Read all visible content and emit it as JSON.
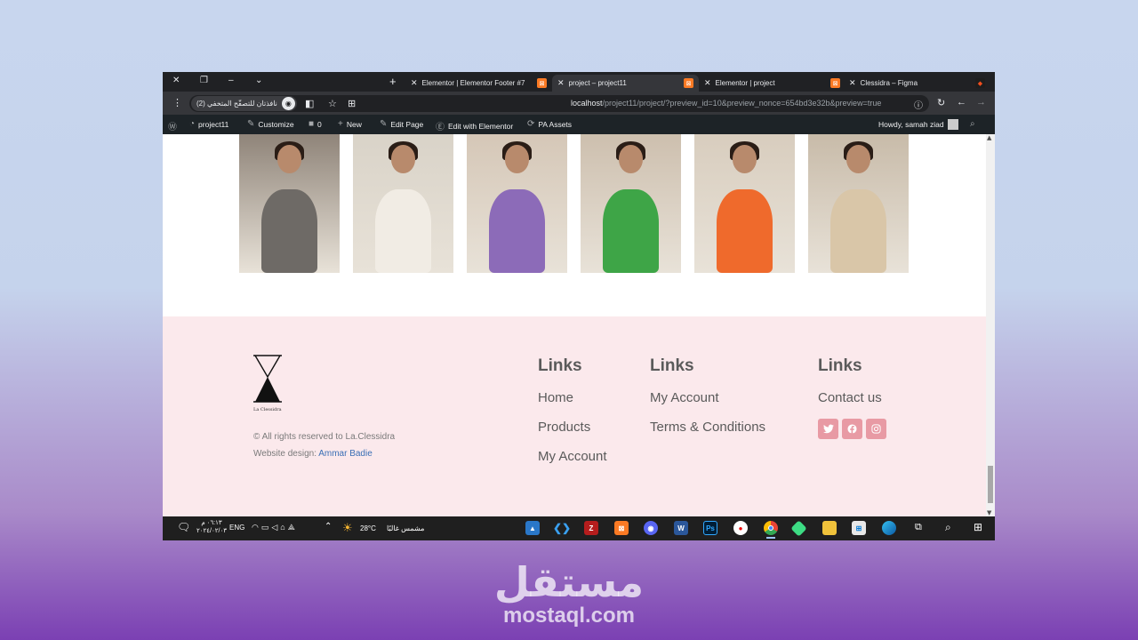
{
  "browser": {
    "tabs": [
      {
        "label": "Elementor | Elementor Footer #7",
        "favicon": "xampp-icon"
      },
      {
        "label": "project – project11",
        "favicon": "xampp-icon",
        "active": true
      },
      {
        "label": "Elementor | project",
        "favicon": "xampp-icon"
      },
      {
        "label": "Clessidra – Figma",
        "favicon": "figma-icon"
      }
    ],
    "incognito_label": "نافذتان للتصفّح المتخفي (2)",
    "url_host": "localhost",
    "url_path": "/project11/project/?preview_id=10&preview_nonce=654bd3e32b&preview=true"
  },
  "wp_admin_bar": {
    "site_name": "project11",
    "customize": "Customize",
    "comments_count": "0",
    "new": "New",
    "edit_page": "Edit Page",
    "edit_elementor": "Edit with Elementor",
    "pa_assets": "PA Assets",
    "howdy": "Howdy, samah ziad"
  },
  "gallery": {
    "photos": [
      {
        "name": "model-grey-cape",
        "bg": "#8f8479",
        "dress": "#6e6a66"
      },
      {
        "name": "model-white-dress",
        "bg": "#d9d3c8",
        "dress": "#f1ece4"
      },
      {
        "name": "model-purple-dress",
        "bg": "#d5c7b7",
        "dress": "#8c6bb8"
      },
      {
        "name": "model-green-dress",
        "bg": "#cdbfae",
        "dress": "#3ea547"
      },
      {
        "name": "model-orange-dress",
        "bg": "#d8cdbe",
        "dress": "#ef6a2c"
      },
      {
        "name": "model-lace-dress",
        "bg": "#c8bba9",
        "dress": "#d9c6a8"
      }
    ]
  },
  "footer": {
    "logo_text": "La Clessidra",
    "copyright": "© All rights reserved to La.Clessidra",
    "design_prefix": "Website design: ",
    "design_author": "Ammar Badie",
    "col1": {
      "title": "Links",
      "links": [
        "Home",
        "Products",
        "My Account"
      ]
    },
    "col2": {
      "title": "Links",
      "links": [
        "My Account",
        "Terms & Conditions"
      ]
    },
    "col3": {
      "title": "Links",
      "links": [
        "Contact us"
      ]
    },
    "social": [
      "twitter-icon",
      "facebook-icon",
      "instagram-icon"
    ],
    "accent": "#e89aa4",
    "bg": "#fbe9ec"
  },
  "taskbar": {
    "time": "٠٦:١٣ م",
    "date": "٢٠٢٤/٠٢/٠٣",
    "lang": "ENG",
    "temp": "28°C",
    "weather": "مشمس غالبًا"
  },
  "watermark": {
    "arabic": "مستقل",
    "english": "mostaql.com"
  }
}
